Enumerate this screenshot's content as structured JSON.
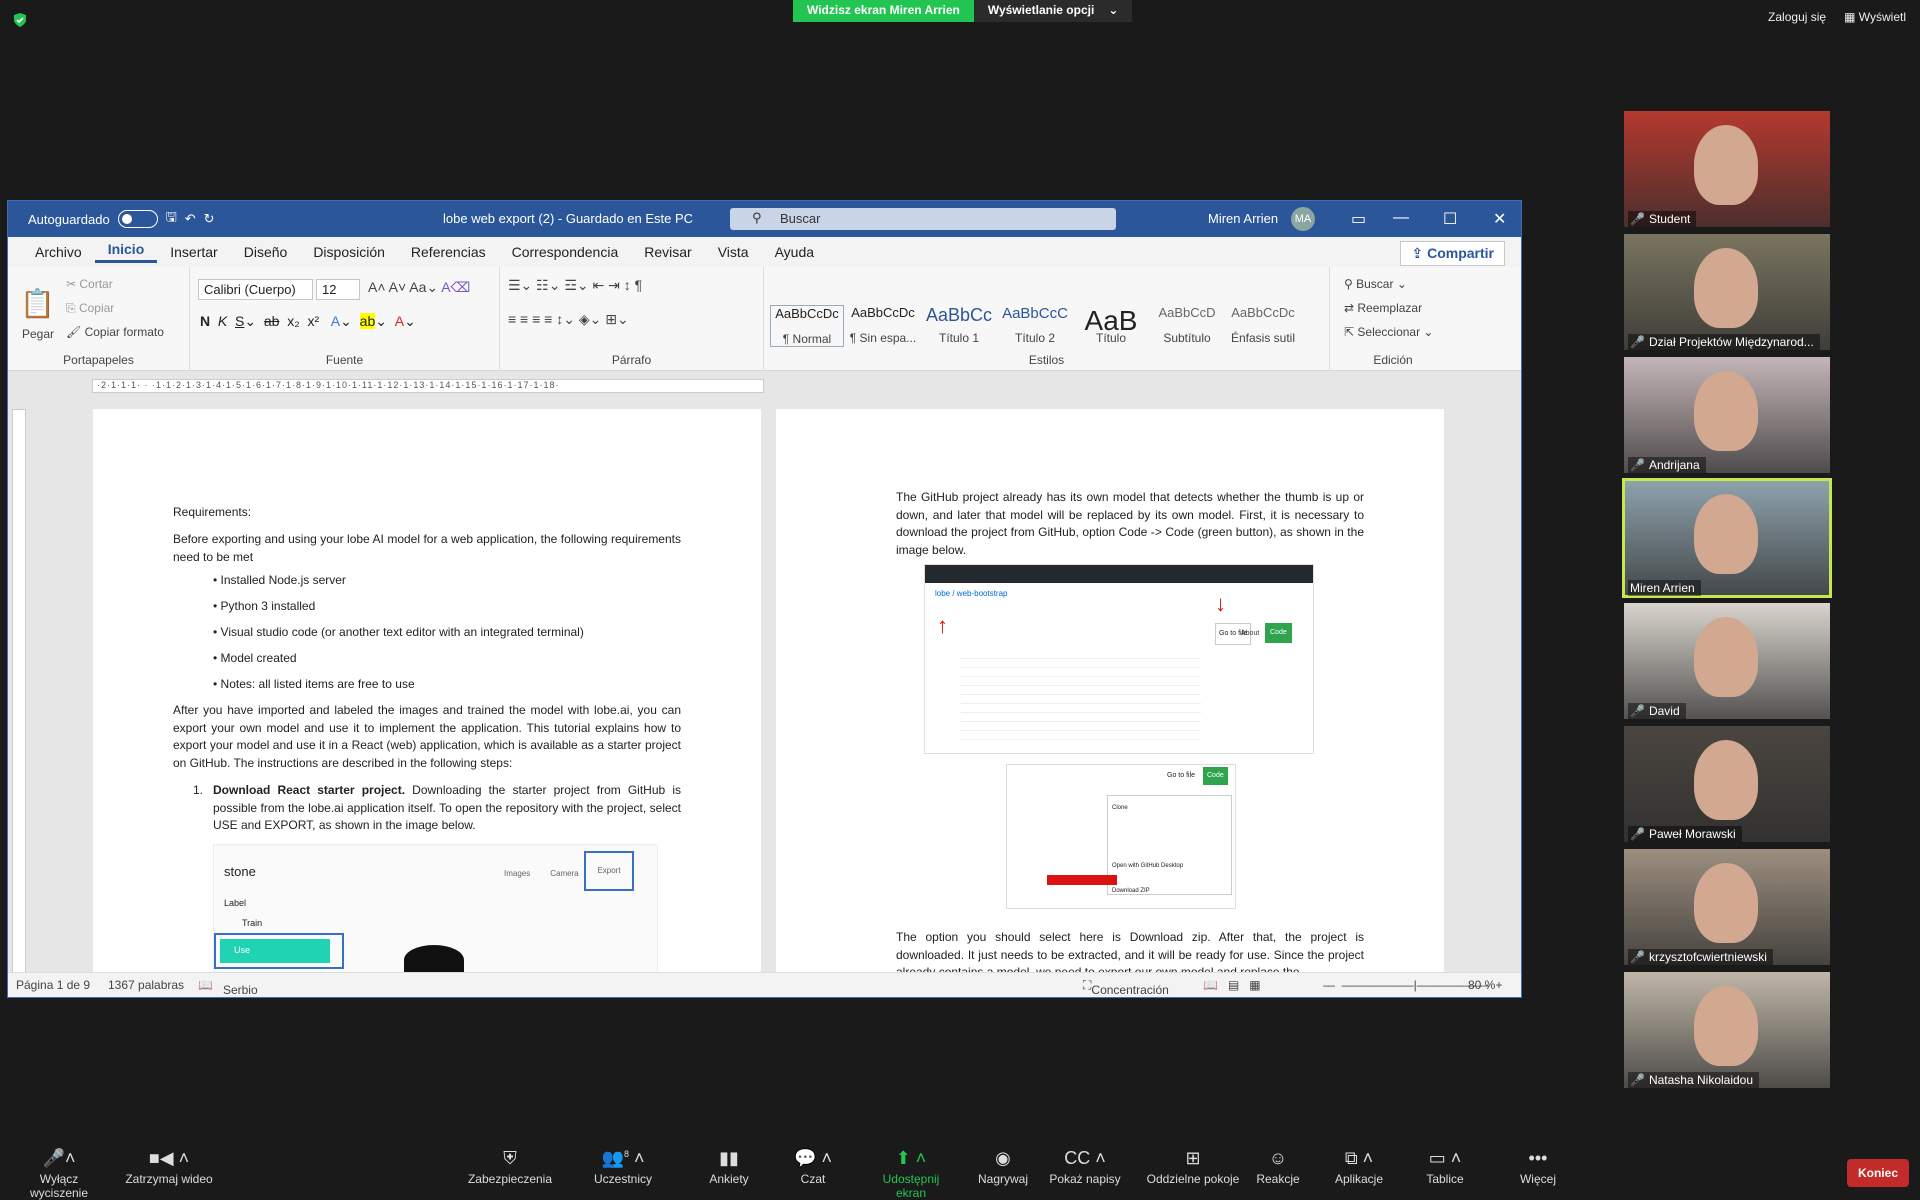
{
  "zoom_top": {
    "share_label": "Widzisz ekran Miren Arrien",
    "options_label": "Wyświetlanie opcji",
    "signin": "Zaloguj się",
    "view": "Wyświetl"
  },
  "word": {
    "autosave": "Autoguardado",
    "title": "lobe web export (2)  -  Guardado en Este PC",
    "search": "Buscar",
    "user": "Miren Arrien",
    "initials": "MA",
    "menus": [
      "Archivo",
      "Inicio",
      "Insertar",
      "Diseño",
      "Disposición",
      "Referencias",
      "Correspondencia",
      "Revisar",
      "Vista",
      "Ayuda"
    ],
    "share": "Compartir",
    "ribbon": {
      "clipboard": {
        "paste": "Pegar",
        "cut": "Cortar",
        "copy": "Copiar",
        "format": "Copiar formato",
        "label": "Portapapeles"
      },
      "font": {
        "name": "Calibri (Cuerpo)",
        "size": "12",
        "label": "Fuente"
      },
      "paragraph": {
        "label": "Párrafo"
      },
      "styles": {
        "label": "Estilos",
        "items": [
          {
            "preview": "AaBbCcDc",
            "name": "¶ Normal"
          },
          {
            "preview": "AaBbCcDc",
            "name": "¶ Sin espa..."
          },
          {
            "preview": "AaBbCc",
            "name": "Título 1"
          },
          {
            "preview": "AaBbCcC",
            "name": "Título 2"
          },
          {
            "preview": "AaB",
            "name": "Título"
          },
          {
            "preview": "AaBbCcD",
            "name": "Subtítulo"
          },
          {
            "preview": "AaBbCcDc",
            "name": "Énfasis sutil"
          }
        ]
      },
      "editing": {
        "find": "Buscar",
        "replace": "Reemplazar",
        "select": "Seleccionar",
        "label": "Edición"
      }
    },
    "ruler": "·2·1·1·1· · ·1·1·2·1·3·1·4·1·5·1·6·1·7·1·8·1·9·1·10·1·11·1·12·1·13·1·14·1·15·1·16·1·17·1·18·",
    "page1": {
      "req": "Requirements:",
      "intro": "Before exporting and using your lobe AI model for a web application, the following requirements need to be met",
      "bullets": [
        "• Installed Node.js server",
        "• Python 3 installed",
        "• Visual studio code (or another text editor with an integrated terminal)",
        "• Model created",
        "• Notes: all listed items are free to use"
      ],
      "para": "After you have imported and labeled the images and trained the model with lobe.ai, you can export your own model and use it to implement the application. This tutorial explains how to export your model and use it in a React (web) application, which is available as a starter project on GitHub. The instructions are described in the following steps:",
      "step_num": "1.",
      "step_bold": "Download React starter project.",
      "step_text": " Downloading the starter project from GitHub is possible from the lobe.ai application itself. To open the repository with the project, select USE and EXPORT, as shown in the image below.",
      "img": {
        "app": "stone",
        "label": "Label",
        "train": "Train",
        "use": "Use",
        "tabs": [
          "Images",
          "Camera",
          "Export"
        ]
      }
    },
    "page2": {
      "para1": "The GitHub project already has its own model that detects whether the thumb is up or down, and later that model will be replaced by its own model. First, it is necessary to download the project from GitHub, option Code -> Code (green button), as shown in the image below.",
      "para2": "The option you should select here is Download zip. After that, the project is downloaded. It just needs to be extracted, and it will be ready for use. Since the project already contains a model, we need to export our own model and replace the",
      "gh": {
        "repo": "lobe / web-bootstrap",
        "code": "Code",
        "goto": "Go to file",
        "clone": "Clone",
        "desktop": "Open with GitHub Desktop",
        "zip": "Download ZIP",
        "about": "About"
      }
    },
    "status": {
      "page": "Página 1 de 9",
      "words": "1367 palabras",
      "lang": "Serbio (latino, Serbia)",
      "focus": "Concentración",
      "zoom": "80 %"
    }
  },
  "participants": [
    {
      "name": "Student",
      "color": "#b5392f"
    },
    {
      "name": "Dział Projektów Międzynarod...",
      "color": "#7a7560"
    },
    {
      "name": "Andrijana",
      "color": "#c4b5b8"
    },
    {
      "name": "Miren Arrien",
      "color": "#8fa3ad"
    },
    {
      "name": "David",
      "color": "#d9d4cd"
    },
    {
      "name": "Paweł Morawski",
      "color": "#4a4540"
    },
    {
      "name": "krzysztofcwiertniewski",
      "color": "#9c8f7f"
    },
    {
      "name": "Natasha Nikolaidou",
      "color": "#bfb6a8"
    }
  ],
  "bottom": {
    "mute": "Wyłącz wyciszenie",
    "video": "Zatrzymaj wideo",
    "security": "Zabezpieczenia",
    "participants": "Uczestnicy",
    "participants_count": "8",
    "polls": "Ankiety",
    "chat": "Czat",
    "share": "Udostępnij ekran",
    "record": "Nagrywaj",
    "cc": "Pokaż napisy",
    "rooms": "Oddzielne pokoje",
    "reactions": "Reakcje",
    "apps": "Aplikacje",
    "whiteboard": "Tablice",
    "more": "Więcej",
    "end": "Koniec"
  }
}
